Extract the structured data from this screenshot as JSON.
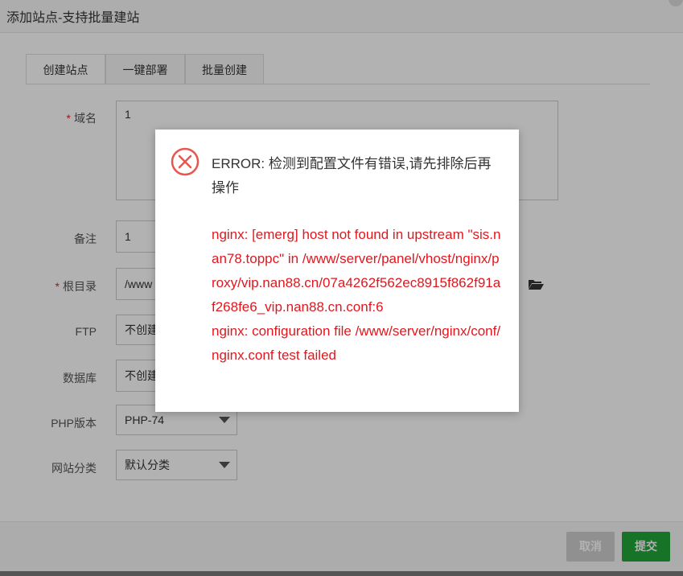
{
  "dialog": {
    "title": "添加站点-支持批量建站",
    "tabs": [
      {
        "label": "创建站点",
        "active": true
      },
      {
        "label": "一键部署",
        "active": false
      },
      {
        "label": "批量创建",
        "active": false
      }
    ]
  },
  "form": {
    "domain": {
      "required": "*",
      "label": "域名",
      "value": "1"
    },
    "remark": {
      "label": "备注",
      "value": "1"
    },
    "root": {
      "required": "*",
      "label": "根目录",
      "value": "/www"
    },
    "ftp": {
      "label": "FTP",
      "value": "不创建"
    },
    "database": {
      "label": "数据库",
      "value": "不创建"
    },
    "php": {
      "label": "PHP版本",
      "value": "PHP-74"
    },
    "category": {
      "label": "网站分类",
      "value": "默认分类"
    }
  },
  "buttons": {
    "cancel": "取消",
    "submit": "提交"
  },
  "error_modal": {
    "title": "ERROR: 检测到配置文件有错误,请先排除后再操作",
    "line1": "nginx: [emerg] host not found in upstream \"sis.nan78.toppc\" in /www/server/panel/vhost/nginx/proxy/vip.nan88.cn/07a4262f562ec8915f862f91af268fe6_vip.nan88.cn.conf:6",
    "line2": "nginx: configuration file /www/server/nginx/conf/nginx.conf test failed"
  },
  "colors": {
    "error_red": "#e0171e",
    "submit_green": "#20a53a",
    "cancel_gray": "#cfcfcf"
  }
}
